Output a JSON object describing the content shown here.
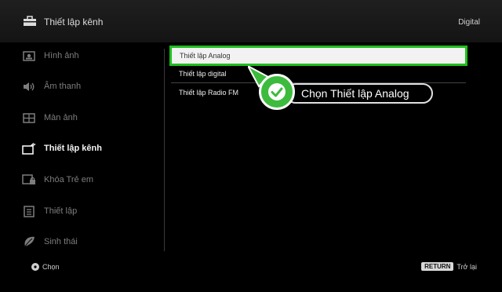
{
  "header": {
    "title": "Thiết lập kênh",
    "mode": "Digital"
  },
  "sidebar": {
    "items": [
      {
        "label": "Hình ảnh",
        "icon": "picture-icon"
      },
      {
        "label": "Âm thanh",
        "icon": "speaker-icon"
      },
      {
        "label": "Màn ảnh",
        "icon": "screen-icon"
      },
      {
        "label": "Thiết lập kênh",
        "icon": "channel-setup-icon",
        "active": true
      },
      {
        "label": "Khóa Trẻ em",
        "icon": "parental-lock-icon"
      },
      {
        "label": "Thiết lập",
        "icon": "settings-icon"
      },
      {
        "label": "Sinh thái",
        "icon": "eco-icon"
      }
    ]
  },
  "menu": {
    "items": [
      {
        "label": "Thiết lập Analog",
        "selected": true
      },
      {
        "label": "Thiết lập digital"
      },
      {
        "label": "Thiết lập Radio FM"
      }
    ]
  },
  "callout": {
    "text": "Chọn Thiết lập Analog"
  },
  "footer": {
    "select_label": "Chọn",
    "return_key": "RETURN",
    "back_label": "Trở lại"
  },
  "colors": {
    "accent": "#1fbf1f",
    "check": "#3dbb3d",
    "background": "#000000"
  }
}
